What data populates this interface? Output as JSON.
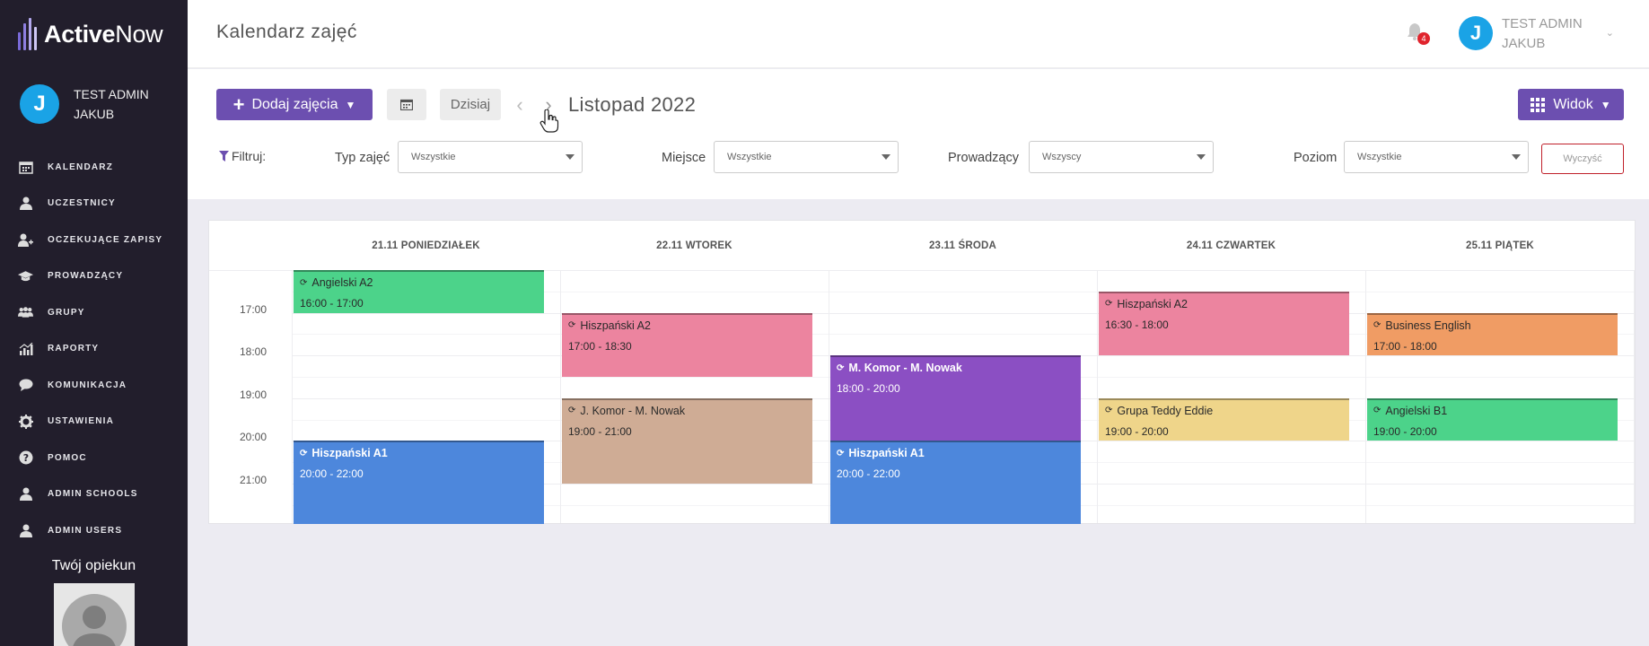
{
  "app": {
    "logo": {
      "bold": "Active",
      "light": "Now"
    },
    "user_name_line1": "TEST ADMIN",
    "user_name_line2": "JAKUB",
    "user_initial": "J"
  },
  "sidebar": {
    "items": [
      {
        "label": "KALENDARZ",
        "icon": "calendar-icon"
      },
      {
        "label": "UCZESTNICY",
        "icon": "user-icon"
      },
      {
        "label": "OCZEKUJĄCE ZAPISY",
        "icon": "user-plus-icon"
      },
      {
        "label": "PROWADZĄCY",
        "icon": "graduation-cap-icon"
      },
      {
        "label": "GRUPY",
        "icon": "users-icon"
      },
      {
        "label": "RAPORTY",
        "icon": "bar-chart-icon"
      },
      {
        "label": "KOMUNIKACJA",
        "icon": "chat-icon"
      },
      {
        "label": "USTAWIENIA",
        "icon": "gear-icon"
      },
      {
        "label": "POMOC",
        "icon": "question-icon"
      },
      {
        "label": "ADMIN SCHOOLS",
        "icon": "user-icon"
      },
      {
        "label": "ADMIN USERS",
        "icon": "user-icon"
      }
    ],
    "guardian_label": "Twój opiekun"
  },
  "header": {
    "title": "Kalendarz zajęć",
    "notifications_count": "4"
  },
  "toolbar": {
    "add_label": "Dodaj zajęcia",
    "today_label": "Dzisiaj",
    "month_label": "Listopad 2022",
    "view_label": "Widok",
    "filter_label": "Filtruj:",
    "filters": [
      {
        "label": "Typ zajęć",
        "value": "Wszystkie"
      },
      {
        "label": "Miejsce",
        "value": "Wszystkie"
      },
      {
        "label": "Prowadzący",
        "value": "Wszyscy"
      },
      {
        "label": "Poziom",
        "value": "Wszystkie"
      }
    ],
    "clear_label": "Wyczyść"
  },
  "calendar": {
    "days": [
      "21.11 PONIEDZIAŁEK",
      "22.11 WTOREK",
      "23.11 ŚRODA",
      "24.11 CZWARTEK",
      "25.11 PIĄTEK"
    ],
    "hours": [
      "17:00",
      "18:00",
      "19:00",
      "20:00",
      "21:00"
    ],
    "events": [
      {
        "day": 0,
        "start": 16.0,
        "end": 17.0,
        "title": "Angielski A2",
        "time": "16:00 - 17:00",
        "color": "#4cd38a",
        "text": "dark",
        "bold": false
      },
      {
        "day": 0,
        "start": 20.0,
        "end": 22.0,
        "title": "Hiszpański A1",
        "time": "20:00 - 22:00",
        "color": "#4d87dc",
        "text": "light",
        "bold": true
      },
      {
        "day": 1,
        "start": 17.0,
        "end": 18.5,
        "title": "Hiszpański A2",
        "time": "17:00 - 18:30",
        "color": "#ec849f",
        "text": "dark",
        "bold": false
      },
      {
        "day": 1,
        "start": 19.0,
        "end": 21.0,
        "title": "J. Komor - M. Nowak",
        "time": "19:00 - 21:00",
        "color": "#cfac95",
        "text": "dark",
        "bold": false
      },
      {
        "day": 2,
        "start": 18.0,
        "end": 20.0,
        "title": "M. Komor - M. Nowak",
        "time": "18:00 - 20:00",
        "color": "#8b4fc3",
        "text": "light",
        "bold": true
      },
      {
        "day": 2,
        "start": 20.0,
        "end": 22.0,
        "title": "Hiszpański A1",
        "time": "20:00 - 22:00",
        "color": "#4d87dc",
        "text": "light",
        "bold": true
      },
      {
        "day": 3,
        "start": 16.5,
        "end": 18.0,
        "title": "Hiszpański A2",
        "time": "16:30 - 18:00",
        "color": "#ec849f",
        "text": "dark",
        "bold": false
      },
      {
        "day": 3,
        "start": 19.0,
        "end": 20.0,
        "title": "Grupa Teddy Eddie",
        "time": "19:00 - 20:00",
        "color": "#efd58a",
        "text": "dark",
        "bold": false
      },
      {
        "day": 4,
        "start": 17.0,
        "end": 18.0,
        "title": "Business English",
        "time": "17:00 - 18:00",
        "color": "#f09c64",
        "text": "dark",
        "bold": false
      },
      {
        "day": 4,
        "start": 19.0,
        "end": 20.0,
        "title": "Angielski B1",
        "time": "19:00 - 20:00",
        "color": "#4cd38a",
        "text": "dark",
        "bold": false
      }
    ]
  },
  "colors": {
    "sidebar_bg": "#221e2c",
    "accent": "#6c4fb0",
    "avatar": "#1aa3e6"
  }
}
